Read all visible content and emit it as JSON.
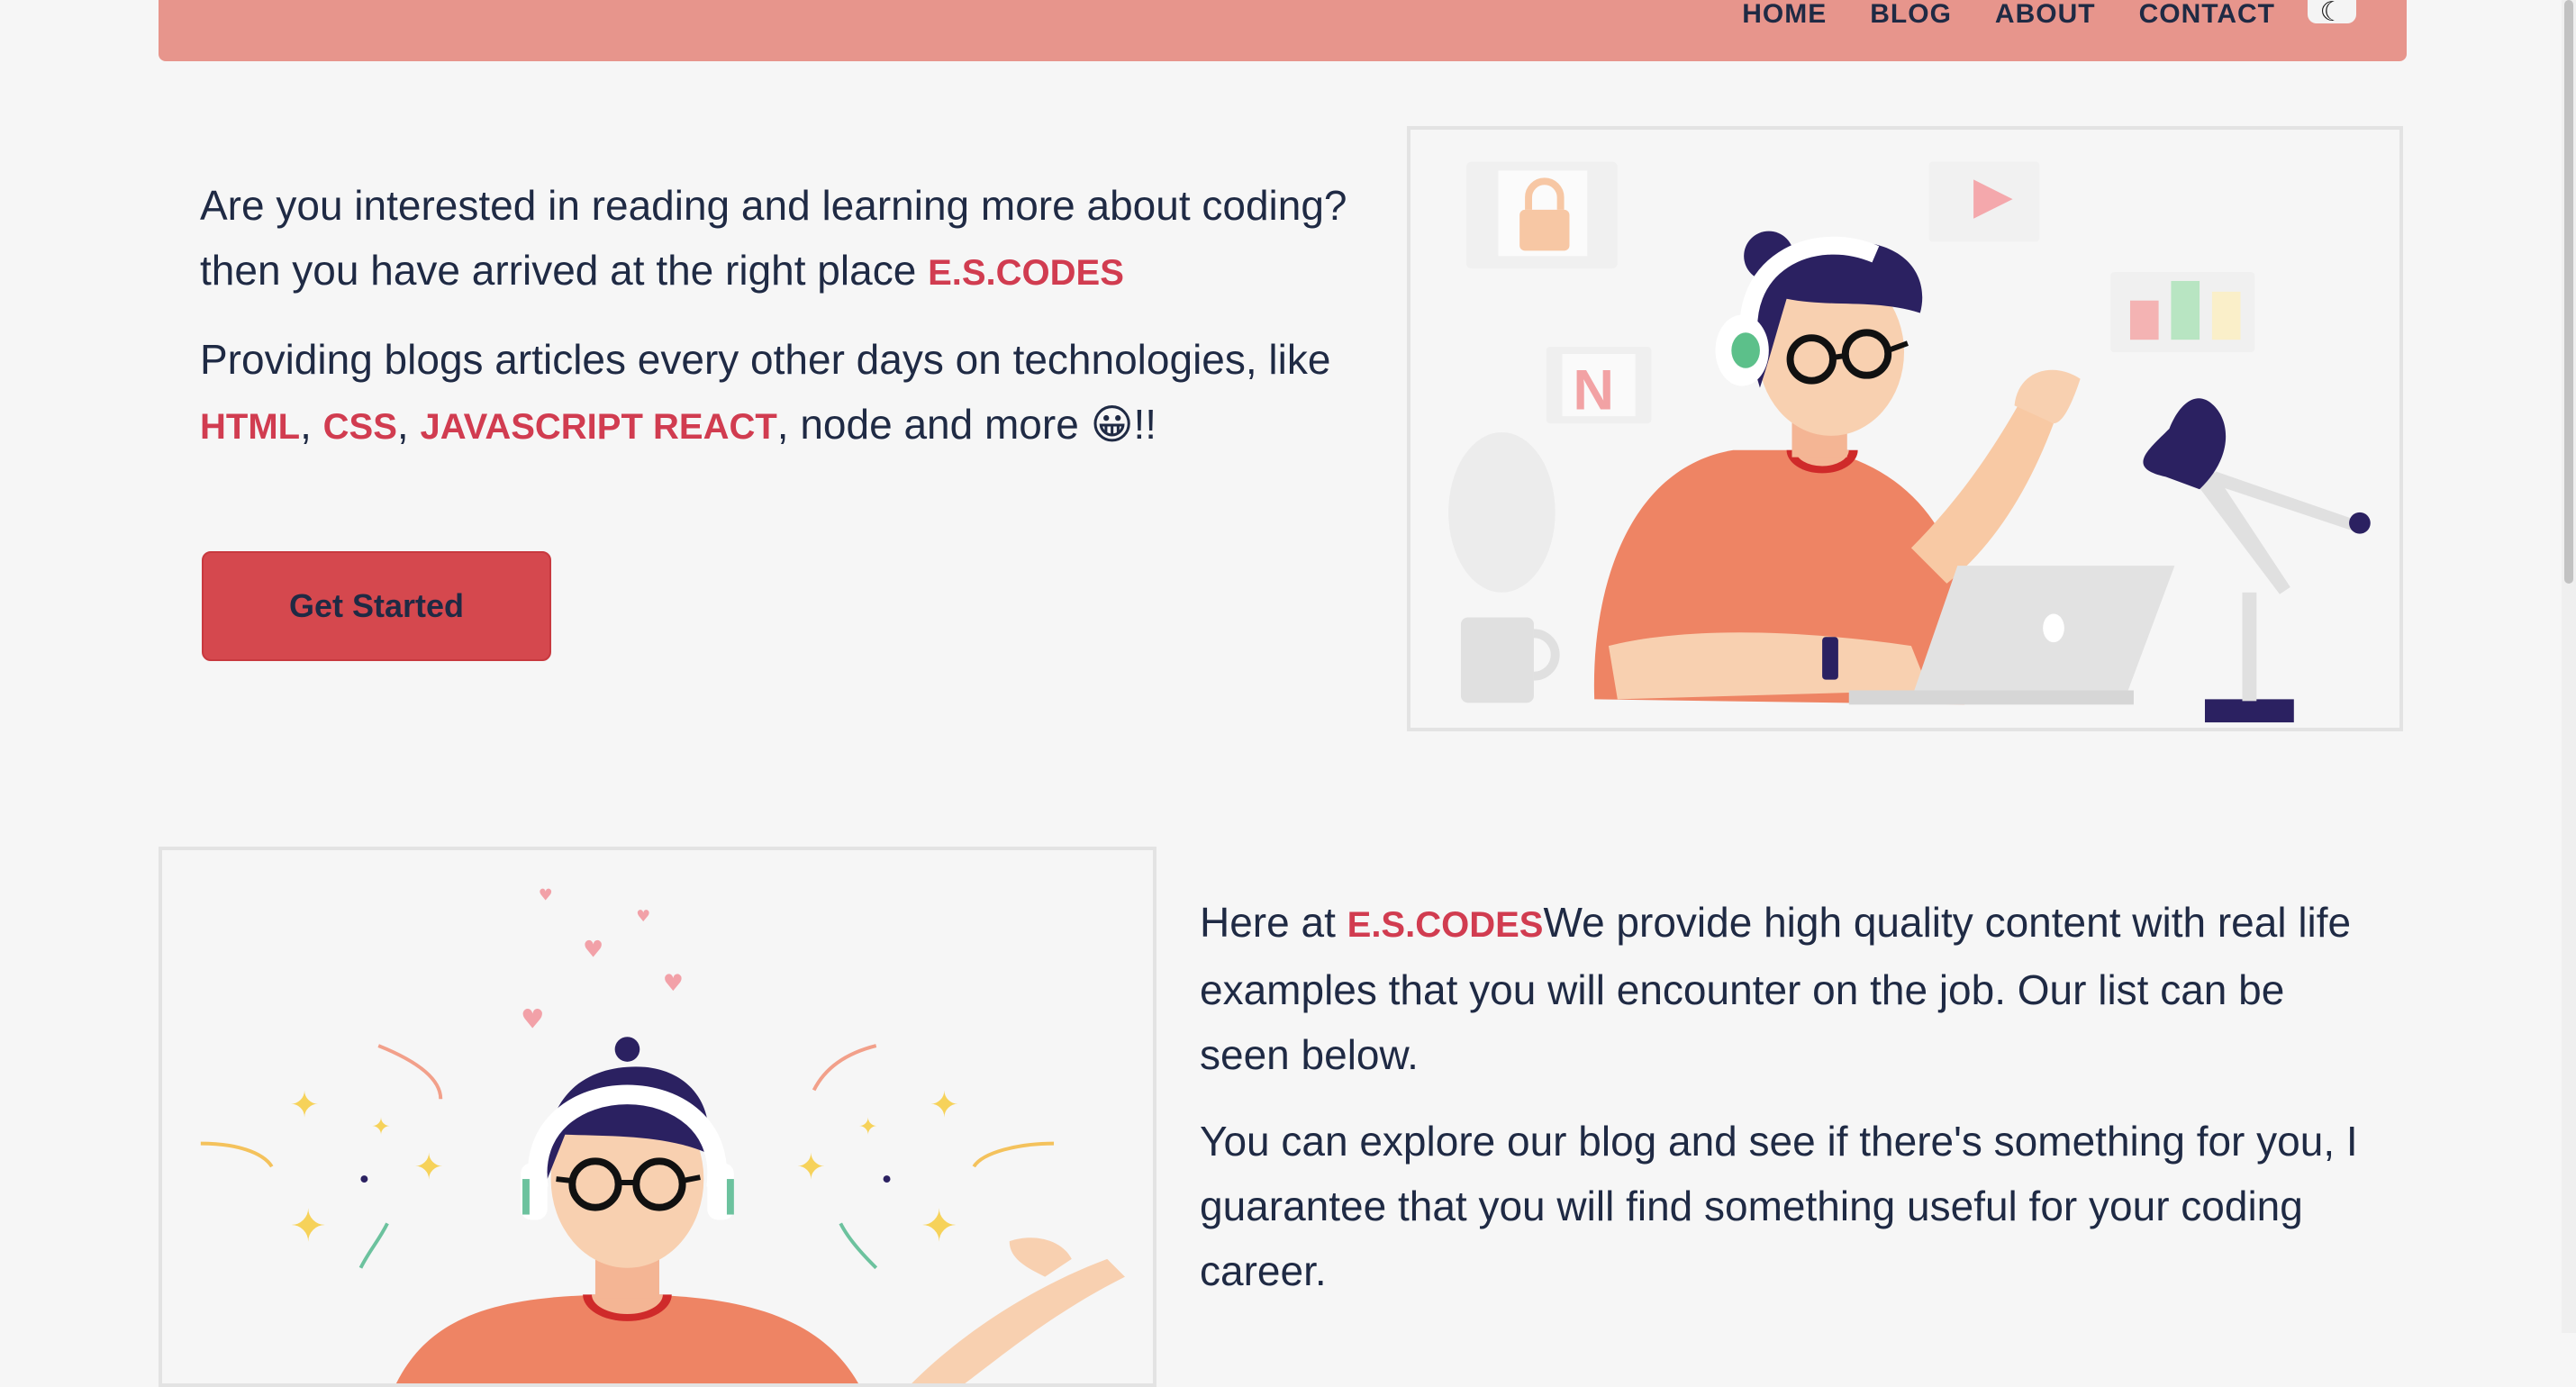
{
  "nav": {
    "links": [
      "HOME",
      "BLOG",
      "ABOUT",
      "CONTACT"
    ],
    "theme_icon": "moon-icon"
  },
  "hero": {
    "line1": "Are you interested in reading and learning more about coding? then you have arrived at the right place ",
    "brand": "E.S.CODES",
    "line2": "Providing blogs articles every other days on technologies, like ",
    "tech_html": "HTML",
    "sep1": ", ",
    "tech_css": "CSS",
    "sep2": ", ",
    "tech_js": "JAVASCRIPT REACT",
    "line2_end": ", node and more 😀!!",
    "cta": "Get Started"
  },
  "about": {
    "intro": "Here at ",
    "brand": "E.S.CODES",
    "para1_rest": "We provide high quality content with real life examples that you will encounter on the job. Our list can be seen below.",
    "para2": "You can explore our blog and see if there's something for you, I guarantee that you will find something useful for your coding career."
  },
  "colors": {
    "navbar": "#e7958c",
    "accent": "#d13c50",
    "button": "#d5484e",
    "text": "#1f2a44",
    "background": "#f6f6f6"
  }
}
